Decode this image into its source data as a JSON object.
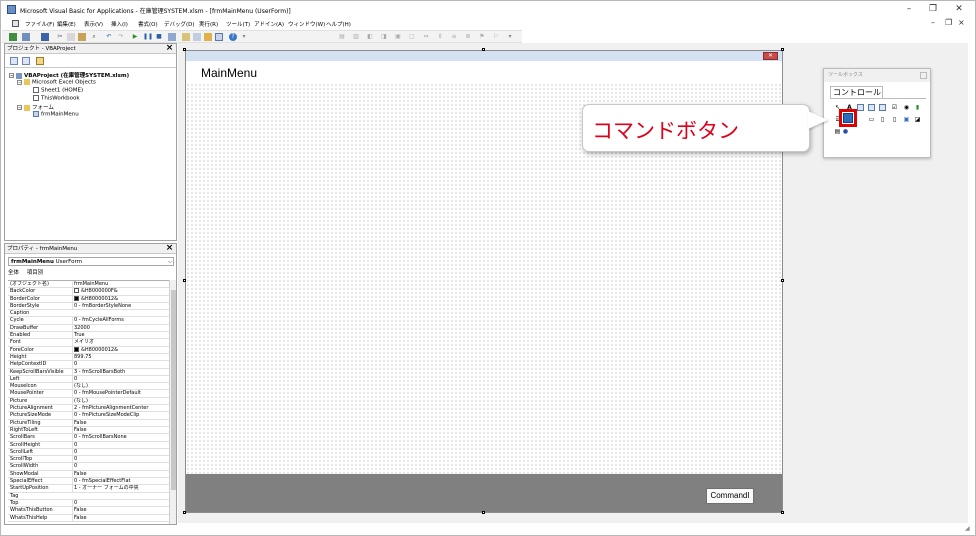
{
  "window": {
    "title": "Microsoft Visual Basic for Applications - 在庫管理SYSTEM.xlsm - [frmMainMenu (UserForm)]",
    "minimize": "–",
    "restore": "❐",
    "close": "✕",
    "mdi_minimize": "–",
    "mdi_restore": "❐",
    "mdi_close": "×"
  },
  "menu": [
    "ファイル(F)",
    "編集(E)",
    "表示(V)",
    "挿入(I)",
    "書式(O)",
    "デバッグ(D)",
    "実行(R)",
    "ツール(T)",
    "アドイン(A)",
    "ウィンドウ(W)",
    "ヘルプ(H)"
  ],
  "project": {
    "title": "プロジェクト - VBAProject",
    "close": "×",
    "tree": [
      {
        "label": "VBAProject (在庫管理SYSTEM.xlsm)",
        "bold": true
      },
      {
        "label": "Microsoft Excel Objects"
      },
      {
        "label": "Sheet1 (HOME)"
      },
      {
        "label": "ThisWorkbook"
      },
      {
        "label": "フォーム"
      },
      {
        "label": "frmMainMenu"
      }
    ]
  },
  "properties": {
    "title": "プロパティ - frmMainMenu",
    "close": "×",
    "object_name": "frmMainMenu",
    "object_type": "UserForm",
    "tab_all": "全体",
    "tab_category": "項目別",
    "rows": [
      {
        "name": "(オブジェクト名)",
        "value": "frmMainMenu"
      },
      {
        "name": "BackColor",
        "value": "&H8000000F&",
        "swatch": "#ffffff"
      },
      {
        "name": "BorderColor",
        "value": "&H80000012&",
        "swatch": "#000000"
      },
      {
        "name": "BorderStyle",
        "value": "0 - fmBorderStyleNone"
      },
      {
        "name": "Caption",
        "value": ""
      },
      {
        "name": "Cycle",
        "value": "0 - fmCycleAllForms"
      },
      {
        "name": "DrawBuffer",
        "value": "32000"
      },
      {
        "name": "Enabled",
        "value": "True"
      },
      {
        "name": "Font",
        "value": "メイリオ"
      },
      {
        "name": "ForeColor",
        "value": "&H80000012&",
        "swatch": "#000000"
      },
      {
        "name": "Height",
        "value": "899.75"
      },
      {
        "name": "HelpContextID",
        "value": "0"
      },
      {
        "name": "KeepScrollBarsVisible",
        "value": "3 - fmScrollBarsBoth"
      },
      {
        "name": "Left",
        "value": "0"
      },
      {
        "name": "MouseIcon",
        "value": "(なし)"
      },
      {
        "name": "MousePointer",
        "value": "0 - fmMousePointerDefault"
      },
      {
        "name": "Picture",
        "value": "(なし)"
      },
      {
        "name": "PictureAlignment",
        "value": "2 - fmPictureAlignmentCenter"
      },
      {
        "name": "PictureSizeMode",
        "value": "0 - fmPictureSizeModeClip"
      },
      {
        "name": "PictureTiling",
        "value": "False"
      },
      {
        "name": "RightToLeft",
        "value": "False"
      },
      {
        "name": "ScrollBars",
        "value": "0 - fmScrollBarsNone"
      },
      {
        "name": "ScrollHeight",
        "value": "0"
      },
      {
        "name": "ScrollLeft",
        "value": "0"
      },
      {
        "name": "ScrollTop",
        "value": "0"
      },
      {
        "name": "ScrollWidth",
        "value": "0"
      },
      {
        "name": "ShowModal",
        "value": "False"
      },
      {
        "name": "SpecialEffect",
        "value": "0 - fmSpecialEffectFlat"
      },
      {
        "name": "StartUpPosition",
        "value": "1 - オーナー フォームの中央"
      },
      {
        "name": "Tag",
        "value": ""
      },
      {
        "name": "Top",
        "value": "0"
      },
      {
        "name": "WhatsThisButton",
        "value": "False"
      },
      {
        "name": "WhatsThisHelp",
        "value": "False"
      }
    ]
  },
  "form": {
    "caption": "MainMenu",
    "close": "✕",
    "command_button": "CommandI"
  },
  "toolbox": {
    "title": "ツールボックス",
    "tab": "コントロール"
  },
  "callout": {
    "text": "コマンドボタン"
  },
  "colors": {
    "callout_text": "#e0001b",
    "highlight": "#e00000",
    "form_footer": "#808080"
  }
}
